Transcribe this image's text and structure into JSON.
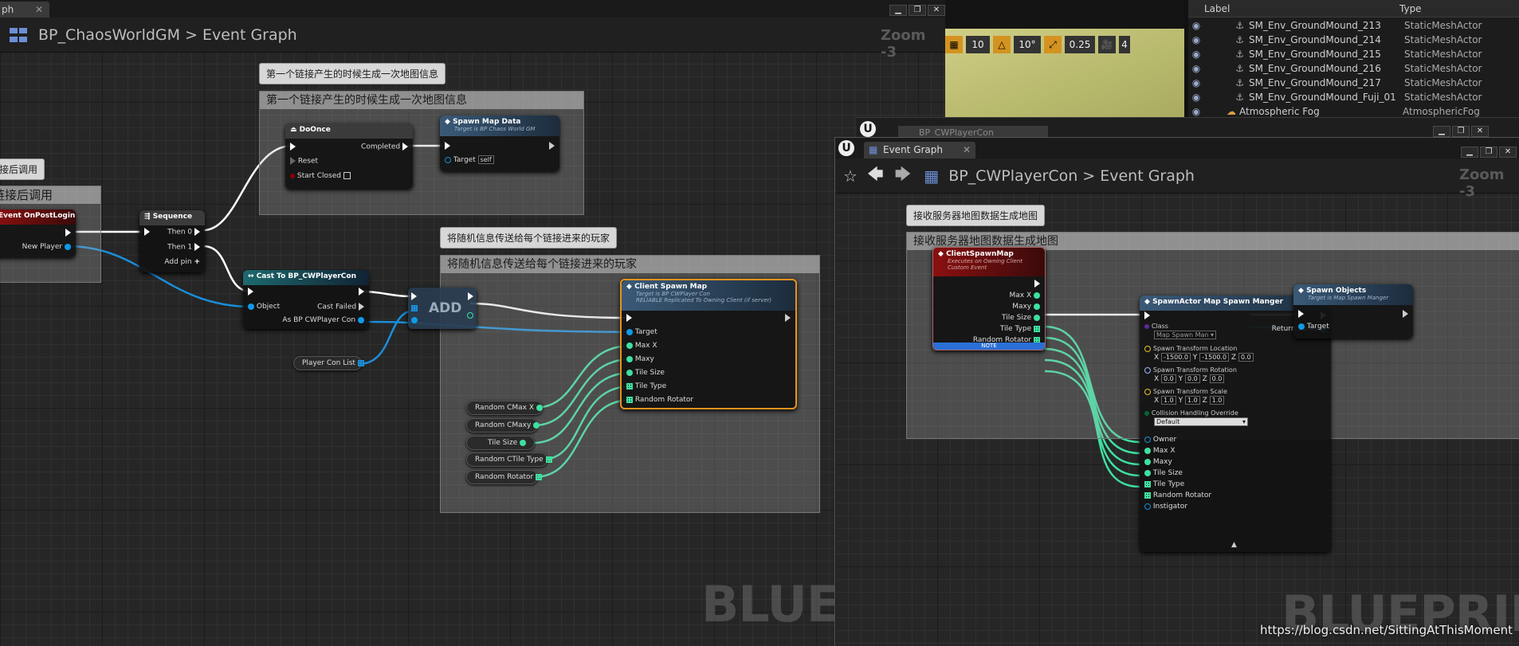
{
  "left_editor": {
    "tab_fragment": "ph",
    "breadcrumb": {
      "blueprint": "BP_ChaosWorldGM",
      "separator": ">",
      "graph": "Event Graph"
    },
    "zoom": "Zoom -3",
    "watermark": "BLUEP",
    "window_buttons": [
      "▁",
      "❐",
      "✕"
    ],
    "comments": [
      {
        "bubble": "第一个链接产生的时候生成一次地图信息",
        "header": "第一个链接产生的时候生成一次地图信息"
      },
      {
        "bubble": "将随机信息传送给每个链接进来的玩家",
        "header": "将随机信息传送给每个链接进来的玩家"
      },
      {
        "bubble": "接后调用",
        "header": "链接后调用"
      }
    ],
    "nodes": {
      "event_post_login": {
        "title": "Event OnPostLogin",
        "pin_new_player": "New Player"
      },
      "sequence": {
        "title": "Sequence",
        "then0": "Then 0",
        "then1": "Then 1",
        "add_pin": "Add pin"
      },
      "do_once": {
        "title": "DoOnce",
        "completed": "Completed",
        "reset": "Reset",
        "start_closed": "Start Closed"
      },
      "spawn_map_data": {
        "title": "Spawn Map Data",
        "subtitle": "Target is BP Chaos World GM",
        "target": "Target",
        "self": "self"
      },
      "cast": {
        "title": "Cast To BP_CWPlayerCon",
        "object": "Object",
        "cast_failed": "Cast Failed",
        "as": "As BP CWPlayer Con"
      },
      "add": {
        "label": "ADD"
      },
      "client_spawn_map": {
        "title": "Client Spawn Map",
        "subtitle1": "Target is BP CWPlayer Con",
        "subtitle2": "RELIABLE Replicated To Owning Client (if server)",
        "pins": [
          "Target",
          "Max X",
          "Maxy",
          "Tile Size",
          "Tile Type",
          "Random Rotator"
        ]
      },
      "player_con_list": "Player Con List",
      "vars": [
        "Random CMax X",
        "Random CMaxy",
        "Tile Size",
        "Random CTile Type",
        "Random Rotator"
      ]
    }
  },
  "viewport_toolbar": {
    "grid_snap": "10",
    "rot_snap": "10°",
    "scale_snap": "0.25",
    "camera_speed": "4"
  },
  "outliner": {
    "columns": {
      "label": "Label",
      "type": "Type"
    },
    "rows": [
      {
        "label": "SM_Env_GroundMound_213",
        "type": "StaticMeshActor"
      },
      {
        "label": "SM_Env_GroundMound_214",
        "type": "StaticMeshActor"
      },
      {
        "label": "SM_Env_GroundMound_215",
        "type": "StaticMeshActor"
      },
      {
        "label": "SM_Env_GroundMound_216",
        "type": "StaticMeshActor"
      },
      {
        "label": "SM_Env_GroundMound_217",
        "type": "StaticMeshActor"
      },
      {
        "label": "SM_Env_GroundMound_Fuji_01",
        "type": "StaticMeshActor"
      },
      {
        "label": "Atmospheric Fog",
        "type": "AtmosphericFog"
      }
    ]
  },
  "back_window": {
    "tab": "BP_CWPlayerCon"
  },
  "right_editor": {
    "tab": "Event Graph",
    "breadcrumb": {
      "blueprint": "BP_CWPlayerCon",
      "separator": ">",
      "graph": "Event Graph"
    },
    "zoom": "Zoom -3",
    "watermark": "BLUEPRINT",
    "comment": {
      "bubble": "接收服务器地图数据生成地图",
      "header": "接收服务器地图数据生成地图"
    },
    "nodes": {
      "client_spawn_event": {
        "title": "ClientSpawnMap",
        "sub1": "Executes on Owning Client",
        "sub2": "Custom Event",
        "pins": [
          "Max X",
          "Maxy",
          "Tile Size",
          "Tile Type",
          "Random Rotator"
        ],
        "note": "NOTE"
      },
      "spawn_actor": {
        "title": "SpawnActor Map Spawn Manger",
        "class_label": "Class",
        "class_value": "Map Spawn Man",
        "return_value": "Return Value",
        "loc_label": "Spawn Transform Location",
        "loc": [
          "-1500.0",
          "-1500.0",
          "0.0"
        ],
        "rot_label": "Spawn Transform Rotation",
        "rot": [
          "0.0",
          "0.0",
          "0.0"
        ],
        "scale_label": "Spawn Transform Scale",
        "scale": [
          "1.0",
          "1.0",
          "1.0"
        ],
        "collision_label": "Collision Handling Override",
        "collision_value": "Default",
        "pins": [
          "Owner",
          "Max X",
          "Maxy",
          "Tile Size",
          "Tile Type",
          "Random Rotator",
          "Instigator"
        ]
      },
      "spawn_objects": {
        "title": "Spawn Objects",
        "subtitle": "Target is Map Spawn Manger",
        "target": "Target"
      }
    }
  },
  "footer_url": "https://blog.csdn.net/SittingAtThisMoment"
}
